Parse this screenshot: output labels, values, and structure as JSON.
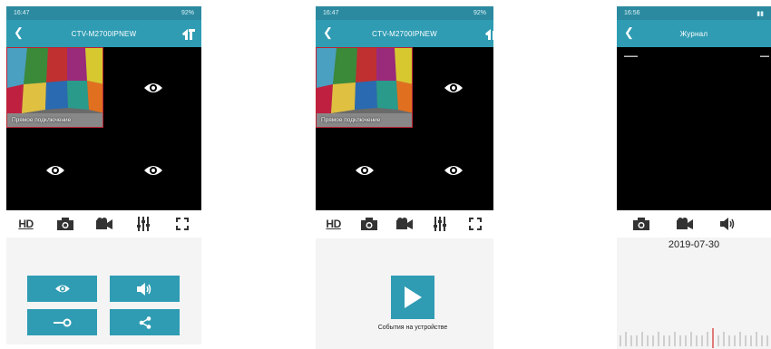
{
  "colors": {
    "accent": "#2f9cb3",
    "status_bar": "#2b8aa0",
    "marker": "#d9534f"
  },
  "screens": [
    {
      "status": {
        "time": "16:47",
        "battery": "92%"
      },
      "title": "CTV-M2700IPNEW",
      "feed_caption": "Прямое подключение",
      "toolbar": {
        "hd": "HD"
      }
    },
    {
      "status": {
        "time": "16:47",
        "battery": "92%"
      },
      "title": "CTV-M2700IPNEW",
      "feed_caption": "Прямое подключение",
      "toolbar": {
        "hd": "HD"
      },
      "events_label": "События на устройстве"
    },
    {
      "status": {
        "time": "16:56"
      },
      "title": "Журнал",
      "date": "2019-07-30"
    }
  ]
}
